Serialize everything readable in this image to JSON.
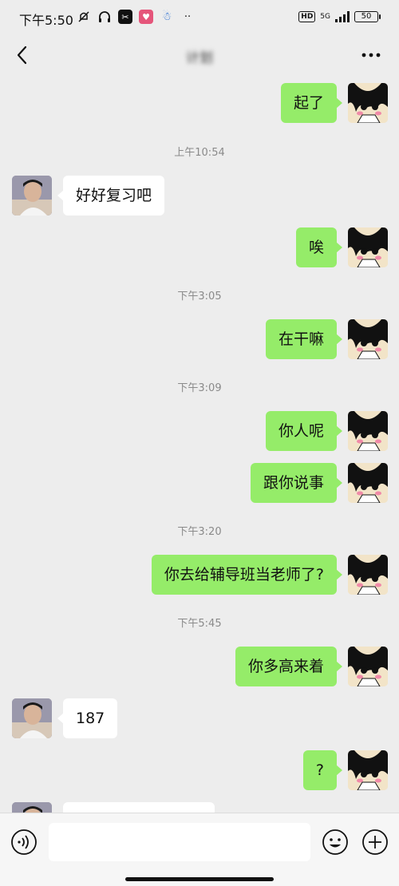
{
  "status_bar": {
    "time": "下午5:50",
    "hd": "HD",
    "network": "5G",
    "battery": "50"
  },
  "nav": {
    "title": "计划"
  },
  "messages": [
    {
      "type": "out",
      "text": "起了"
    },
    {
      "type": "time",
      "text": "上午10:54"
    },
    {
      "type": "in",
      "text": "好好复习吧"
    },
    {
      "type": "out",
      "text": "唉"
    },
    {
      "type": "time",
      "text": "下午3:05"
    },
    {
      "type": "out",
      "text": "在干嘛"
    },
    {
      "type": "time",
      "text": "下午3:09"
    },
    {
      "type": "out",
      "text": "你人呢"
    },
    {
      "type": "out",
      "text": "跟你说事"
    },
    {
      "type": "time",
      "text": "下午3:20"
    },
    {
      "type": "out",
      "text": "你去给辅导班当老师了?"
    },
    {
      "type": "time",
      "text": "下午5:45"
    },
    {
      "type": "out",
      "text": "你多高来着"
    },
    {
      "type": "in",
      "text": "187"
    },
    {
      "type": "out",
      "text": "?"
    }
  ],
  "input": {
    "value": "",
    "placeholder": ""
  },
  "colors": {
    "background": "#ededed",
    "bubble_out": "#95ec69",
    "bubble_in": "#ffffff",
    "timestamp": "#8a8a8a"
  },
  "icons": {
    "back": "chevron-left-icon",
    "more": "more-dots-icon",
    "voice": "voice-icon",
    "emoji": "emoji-icon",
    "plus": "plus-icon"
  }
}
